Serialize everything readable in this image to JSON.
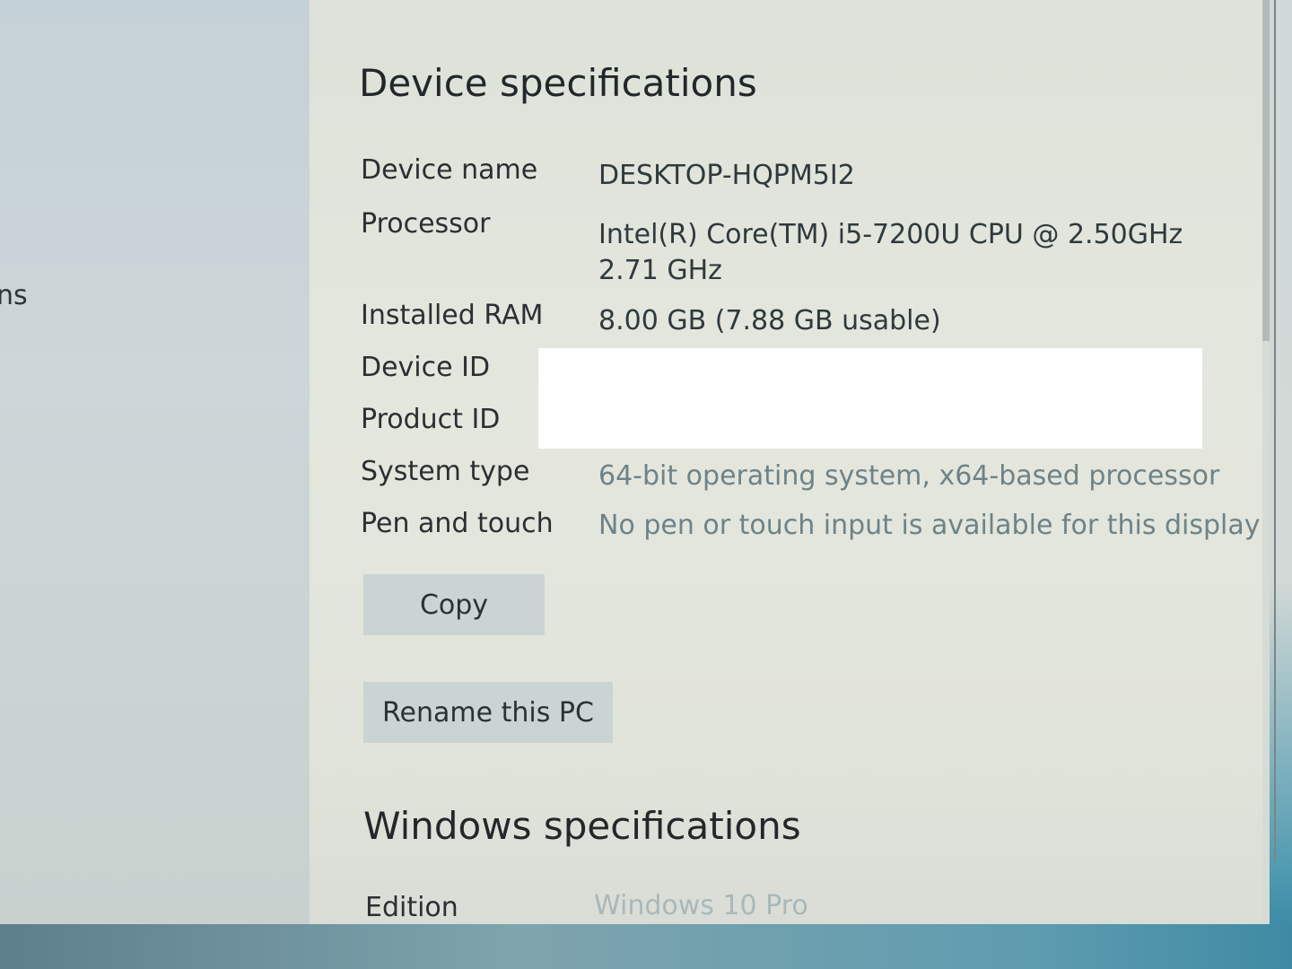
{
  "nav": {
    "partial_item": "ns"
  },
  "device_specifications": {
    "title": "Device specifications",
    "rows": [
      {
        "label": "Device name",
        "value": "DESKTOP-HQPM5I2"
      },
      {
        "label": "Processor",
        "value": "Intel(R) Core(TM) i5-7200U CPU @ 2.50GHz   2.71 GHz"
      },
      {
        "label": "Installed RAM",
        "value": "8.00 GB (7.88 GB usable)"
      },
      {
        "label": "Device ID",
        "value": ""
      },
      {
        "label": "Product ID",
        "value": ""
      },
      {
        "label": "System type",
        "value": "64-bit operating system, x64-based processor"
      },
      {
        "label": "Pen and touch",
        "value": "No pen or touch input is available for this display"
      }
    ],
    "copy_label": "Copy",
    "rename_label": "Rename this PC"
  },
  "windows_specifications": {
    "title": "Windows specifications",
    "rows": [
      {
        "label": "Edition",
        "value": "Windows 10 Pro"
      }
    ]
  },
  "colors": {
    "accent_taskbar": "#3f8aa3",
    "redaction": "#ffffff"
  }
}
